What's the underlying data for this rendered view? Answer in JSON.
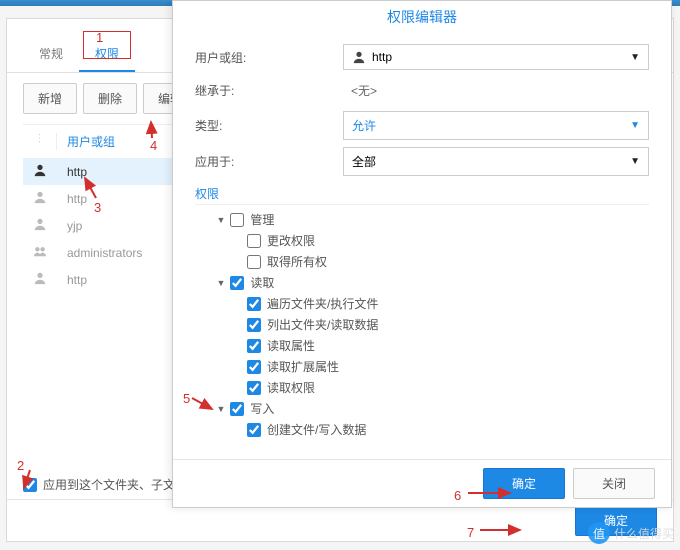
{
  "annots": {
    "n1": "1",
    "n2": "2",
    "n3": "3",
    "n4": "4",
    "n5": "5",
    "n6": "6",
    "n7": "7"
  },
  "tabs": {
    "general": "常规",
    "perm": "权限"
  },
  "toolbar": {
    "add": "新增",
    "del": "删除",
    "edit": "编辑"
  },
  "list": {
    "header": "用户或组",
    "items": [
      "http",
      "http",
      "yjp",
      "administrators",
      "http"
    ]
  },
  "applyRow": {
    "label": "应用到这个文件夹、子文"
  },
  "footer": {
    "ok": "确定"
  },
  "modal": {
    "title": "权限编辑器",
    "form": {
      "userLabel": "用户或组:",
      "userValue": "http",
      "inheritLabel": "继承于:",
      "inheritValue": "<无>",
      "typeLabel": "类型:",
      "typeValue": "允许",
      "applyLabel": "应用于:",
      "applyValue": "全部"
    },
    "permHeader": "权限",
    "tree": {
      "admin": "管理",
      "adminChange": "更改权限",
      "adminTake": "取得所有权",
      "read": "读取",
      "readTraverse": "遍历文件夹/执行文件",
      "readList": "列出文件夹/读取数据",
      "readAttr": "读取属性",
      "readExt": "读取扩展属性",
      "readPerm": "读取权限",
      "write": "写入",
      "writeCreate": "创建文件/写入数据"
    },
    "buttons": {
      "ok": "确定",
      "close": "关闭"
    }
  },
  "watermark": {
    "logo": "值",
    "text": "什么值得买"
  }
}
